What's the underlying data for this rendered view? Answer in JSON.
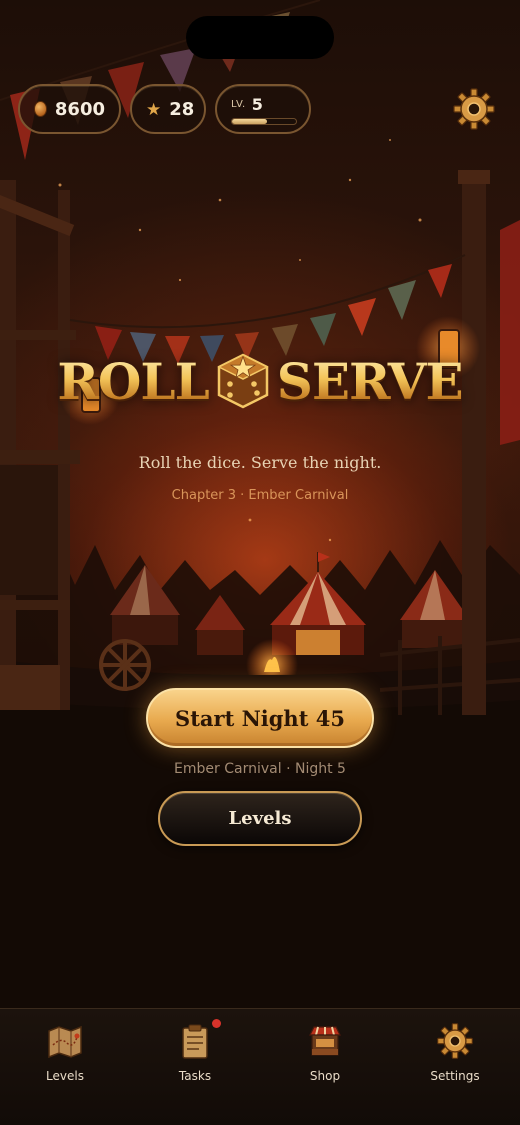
{
  "hud": {
    "coins": "8600",
    "stars": "28",
    "level_tag": "LV.",
    "level": "5",
    "level_progress": 0.55,
    "coin_icon": "coin-icon",
    "star_icon": "star-icon",
    "settings_icon": "gear-icon"
  },
  "title": {
    "word_left": "ROLL",
    "word_right": "SERVE",
    "emblem_icon": "star-die-icon",
    "tagline": "Roll the dice. Serve the night.",
    "chapter": "Chapter 3 · Ember Carnival"
  },
  "actions": {
    "start_label": "Start Night 45",
    "start_sub": "Ember Carnival · Night 5",
    "levels_label": "Levels"
  },
  "nav": {
    "items": [
      {
        "label": "Levels",
        "icon": "map-icon"
      },
      {
        "label": "Tasks",
        "icon": "clipboard-icon",
        "has_badge": true
      },
      {
        "label": "Shop",
        "icon": "shop-stall-icon"
      },
      {
        "label": "Settings",
        "icon": "gear-icon"
      }
    ]
  },
  "colors": {
    "accent_gold": "#e8a94e",
    "badge_red": "#d8332b",
    "chapter_text": "#d9955a"
  }
}
